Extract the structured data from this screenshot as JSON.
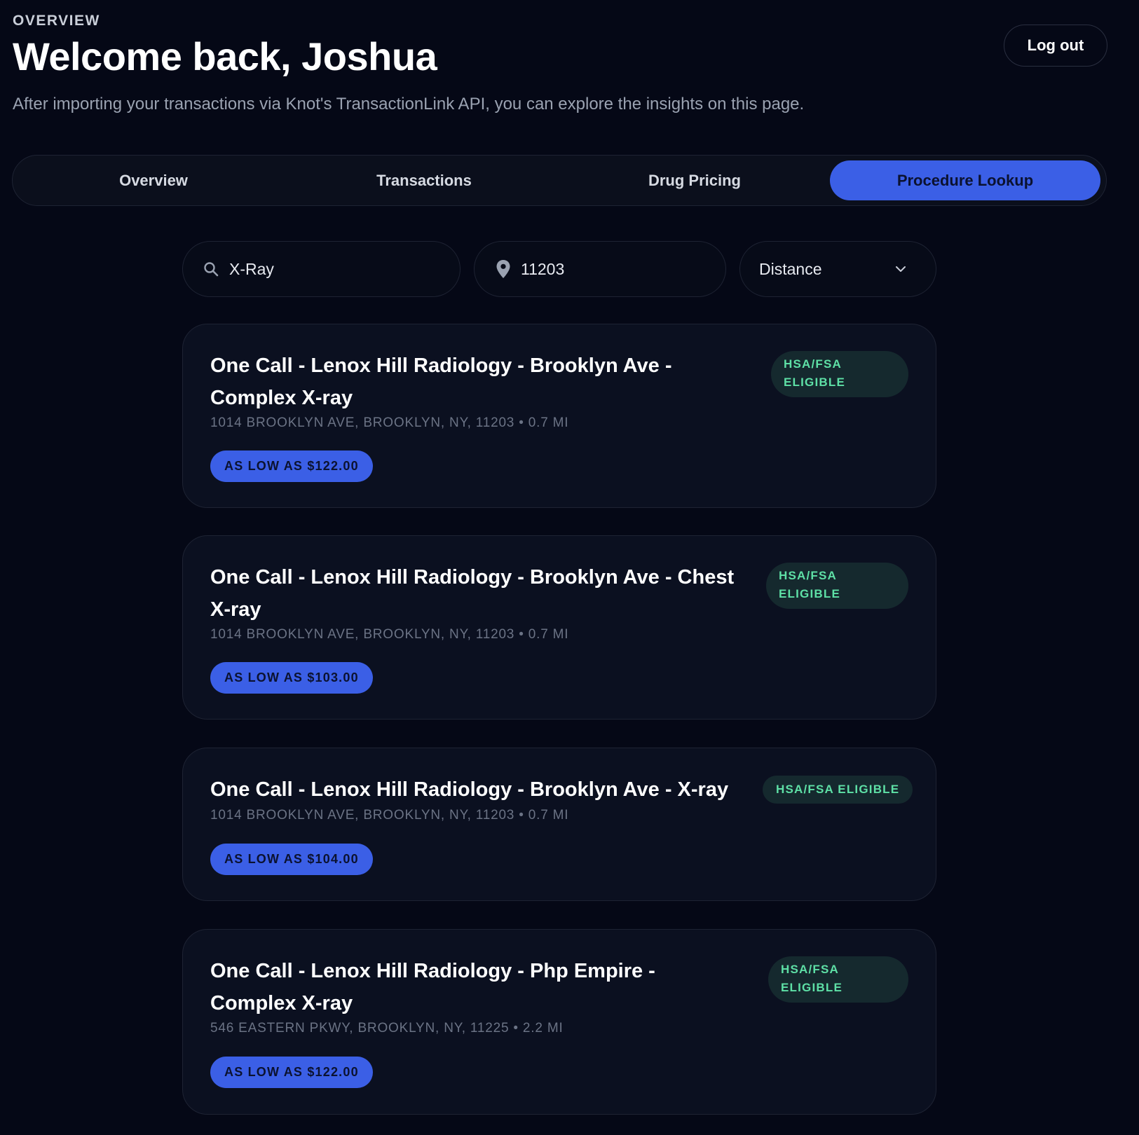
{
  "header": {
    "eyebrow": "OVERVIEW",
    "title": "Welcome back, Joshua",
    "subtitle": "After importing your transactions via Knot's TransactionLink API, you can explore the insights on this page.",
    "logout_label": "Log out"
  },
  "tabs": [
    {
      "label": "Overview",
      "active": false
    },
    {
      "label": "Transactions",
      "active": false
    },
    {
      "label": "Drug Pricing",
      "active": false
    },
    {
      "label": "Procedure Lookup",
      "active": true
    }
  ],
  "search": {
    "query": "X-Ray",
    "zip": "11203",
    "sort": "Distance",
    "icons": [
      "search-icon",
      "map-pin-icon",
      "chevron-down-icon"
    ]
  },
  "results": [
    {
      "title": "One Call - Lenox Hill Radiology - Brooklyn Ave - Complex X-ray",
      "address": "1014 BROOKLYN AVE, BROOKLYN, NY, 11203 • 0.7 MI",
      "price": "AS LOW AS $122.00",
      "badge": "HSA/FSA ELIGIBLE"
    },
    {
      "title": "One Call - Lenox Hill Radiology - Brooklyn Ave - Chest X-ray",
      "address": "1014 BROOKLYN AVE, BROOKLYN, NY, 11203 • 0.7 MI",
      "price": "AS LOW AS $103.00",
      "badge": "HSA/FSA ELIGIBLE"
    },
    {
      "title": "One Call - Lenox Hill Radiology - Brooklyn Ave - X-ray",
      "address": "1014 BROOKLYN AVE, BROOKLYN, NY, 11203 • 0.7 MI",
      "price": "AS LOW AS $104.00",
      "badge": "HSA/FSA ELIGIBLE"
    },
    {
      "title": "One Call - Lenox Hill Radiology - Php Empire - Complex X-ray",
      "address": "546 EASTERN PKWY, BROOKLYN, NY, 11225 • 2.2 MI",
      "price": "AS LOW AS $122.00",
      "badge": "HSA/FSA ELIGIBLE"
    }
  ],
  "colors": {
    "background": "#050816",
    "accent": "#3b5fe6",
    "badge_bg": "#15292e",
    "badge_text": "#5ee0a6"
  }
}
